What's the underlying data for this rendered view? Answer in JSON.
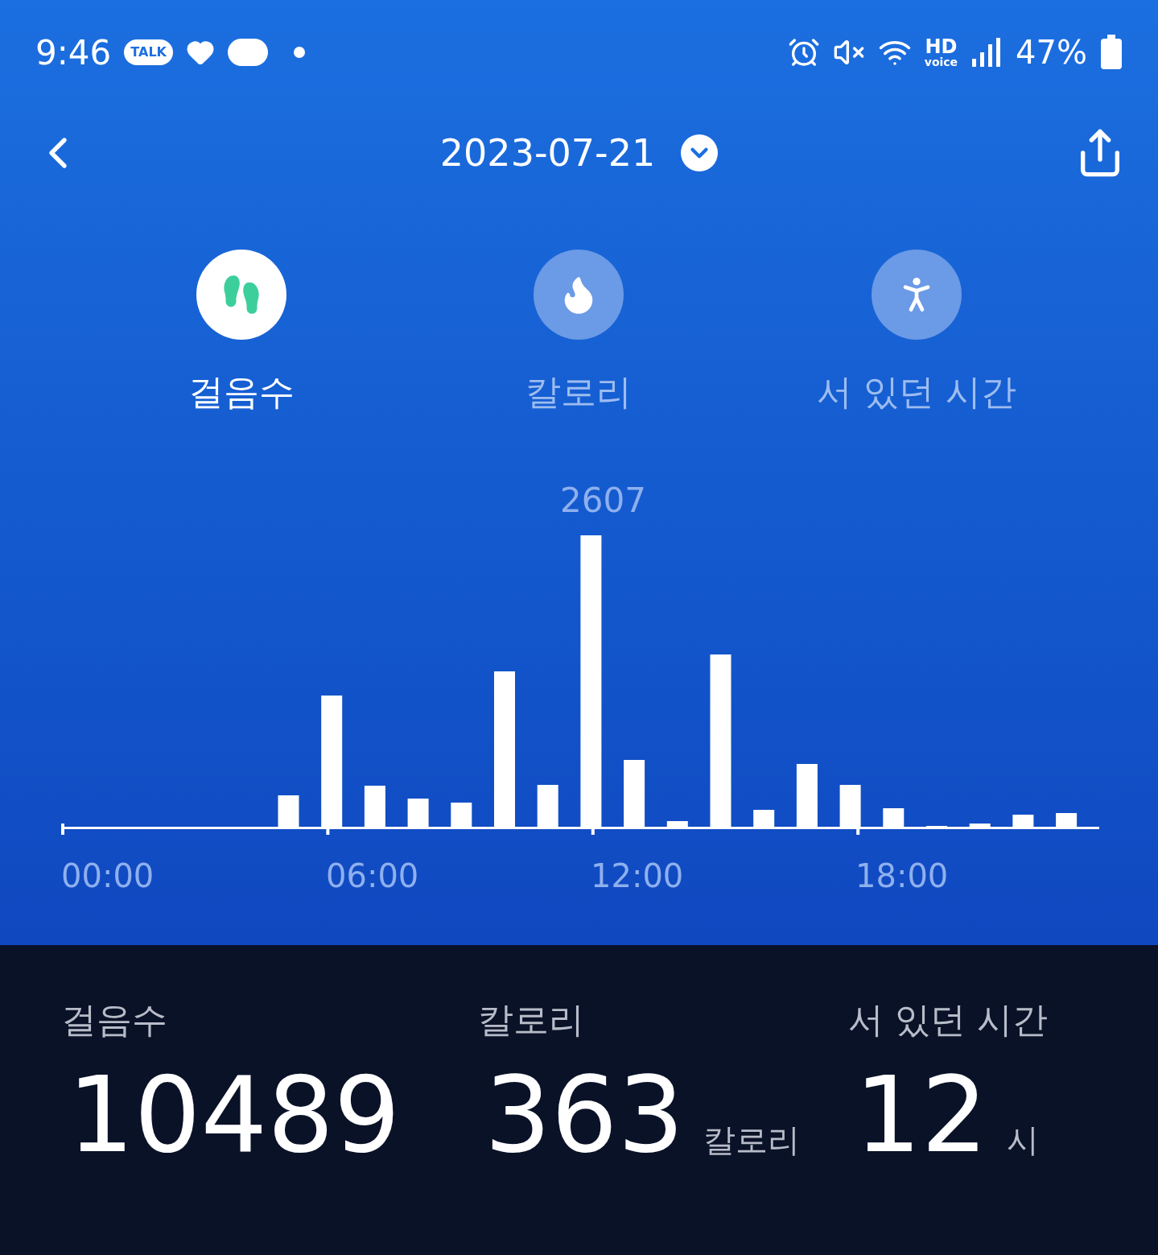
{
  "status_bar": {
    "time": "9:46",
    "talk_badge": "TALK",
    "hd": "HD",
    "voice": "voice",
    "battery": "47%"
  },
  "header": {
    "date": "2023-07-21"
  },
  "tabs": [
    {
      "kind": "steps",
      "label": "걸음수",
      "selected": true
    },
    {
      "kind": "calories",
      "label": "칼로리",
      "selected": false
    },
    {
      "kind": "standing",
      "label": "서 있던 시간",
      "selected": false
    }
  ],
  "chart": {
    "peak_label": "2607",
    "x_labels": [
      "00:00",
      "06:00",
      "12:00",
      "18:00"
    ]
  },
  "summary": [
    {
      "label": "걸음수",
      "value": "10489"
    },
    {
      "label": "칼로리",
      "value": "363",
      "unit": "칼로리"
    },
    {
      "label": "서 있던 시간",
      "value": "12",
      "unit": "시"
    }
  ]
}
